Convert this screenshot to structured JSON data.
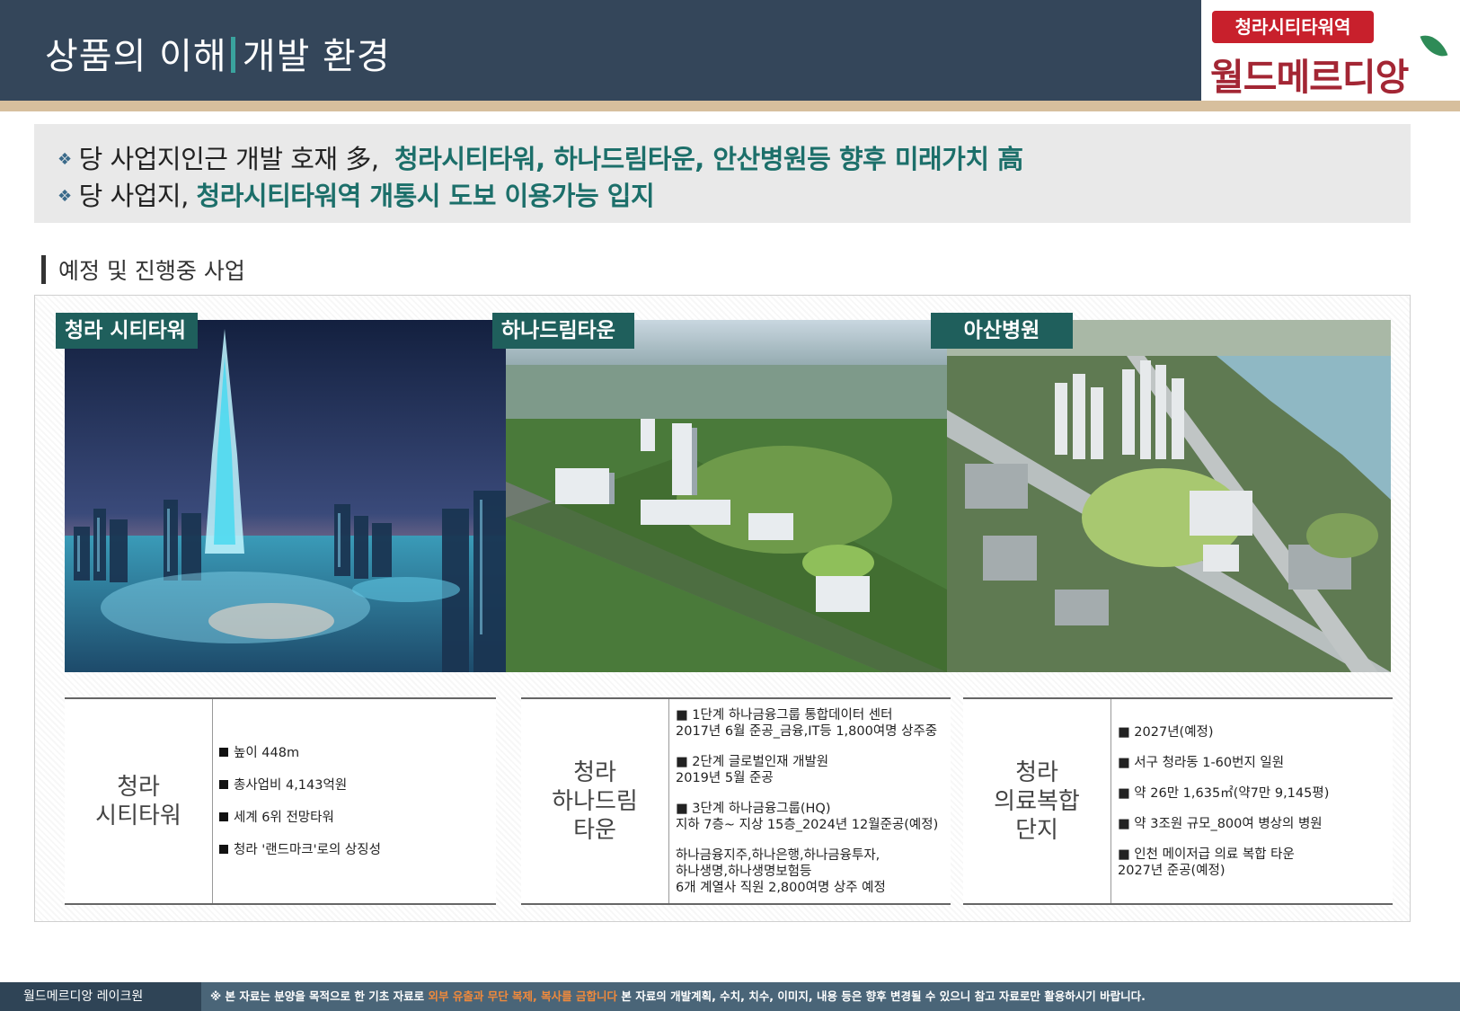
{
  "header": {
    "title_left": "상품의 이해",
    "title_right": "개발 환경",
    "logo_badge": "청라시티타워역",
    "logo_text": "월드메르디앙"
  },
  "summary": {
    "line1_prefix": "당 사업지인근 개발 호재 多,",
    "line1_highlight": "청라시티타워, 하나드림타운, 안산병원등 향후 미래가치 高",
    "line2_prefix": "당 사업지,",
    "line2_highlight": "청라시티타워역 개통시 도보 이용가능 입지"
  },
  "section_title": "예정 및 진행중 사업",
  "projects": [
    {
      "tag": "청라 시티타워",
      "name": "청라\n시티타워",
      "items": [
        "높이 448m",
        "총사업비 4,143억원",
        "세계 6위 전망타워",
        "청라 '랜드마크'로의 상징성"
      ]
    },
    {
      "tag": "하나드림타운",
      "name": "청라\n하나드림\n타운",
      "items": [
        "■ 1단계 하나금융그룹 통합데이터 센터\n2017년 6월 준공_금융,IT등 1,800여명 상주중",
        "■ 2단계 글로벌인재 개발원\n2019년 5월 준공",
        "■ 3단계 하나금융그룹(HQ)\n지하 7층~ 지상 15층_2024년 12월준공(예정)",
        "하나금융지주,하나은행,하나금융투자,\n하나생명,하나생명보험등\n6개 계열사 직원 2,800여명 상주 예정"
      ]
    },
    {
      "tag": "아산병원",
      "name": "청라\n의료복합\n단지",
      "items": [
        "■ 2027년(예정)",
        "■ 서구 청라동 1-60번지 일원",
        "■ 약 26만 1,635㎡(약7만 9,145평)",
        "■ 약 3조원 규모_800여 병상의 병원",
        "■ 인천 메이저급 의료 복합 타운\n2027년 준공(예정)"
      ]
    }
  ],
  "footer": {
    "left": "월드메르디앙 레이크원",
    "right_prefix": "※ 본 자료는 분양을 목적으로 한 기초 자료로",
    "right_warn": "외부 유출과 무단 복제, 복사를 금합니다",
    "right_suffix": "본 자료의 개발계획, 수치, 치수, 이미지, 내용 등은 향후 변경될 수 있으니 참고 자료로만 활용하시기 바랍니다."
  },
  "colors": {
    "header_bg": "#34465a",
    "accent_teal": "#1f5f5c",
    "highlight_text": "#1c6f6a",
    "logo_red": "#c8202c",
    "tan_line": "#d7bf9d",
    "footer_bg": "#4a6578",
    "footer_warn": "#f08a3c"
  }
}
